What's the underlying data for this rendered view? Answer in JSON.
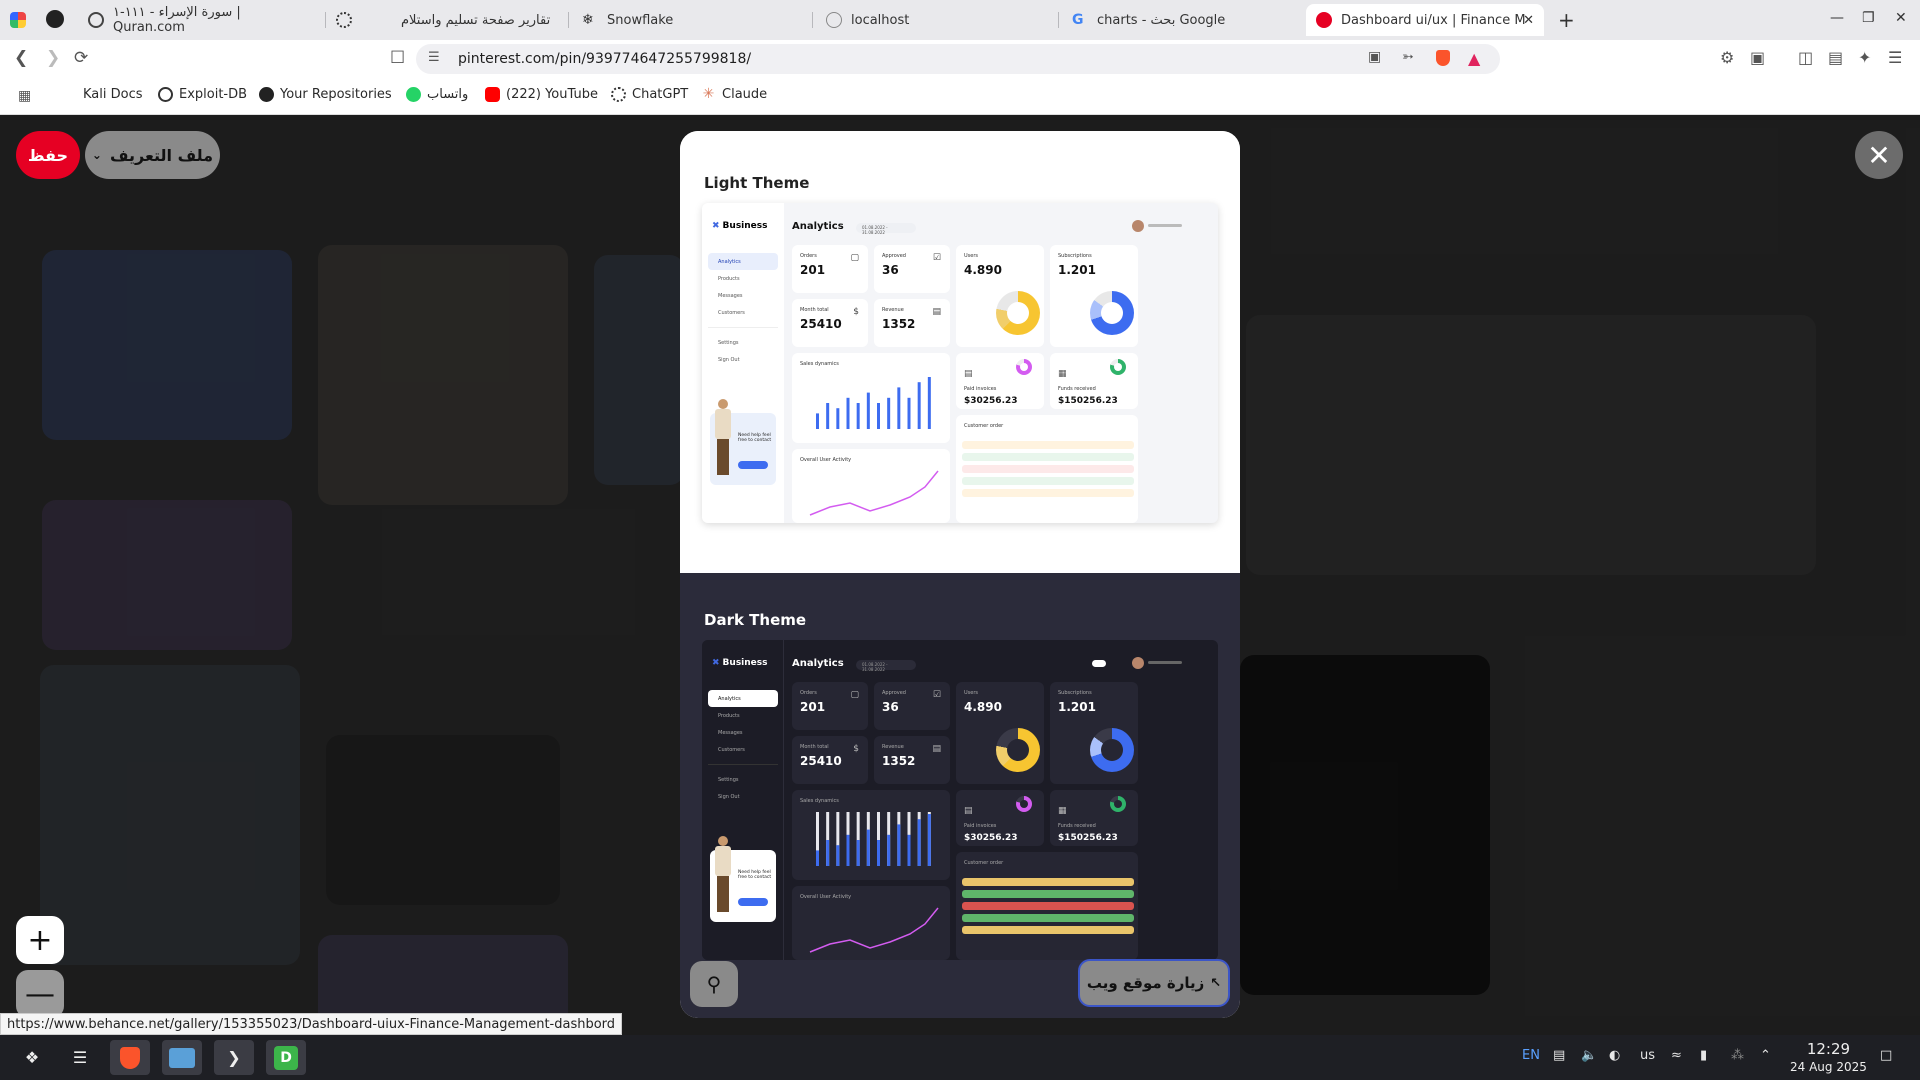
{
  "browser": {
    "tabs": [
      {
        "title": "سورة الإسراء - ١١١-١ | Quran.com",
        "icon": "quran-icon"
      },
      {
        "title": "تقارير صفحة تسليم واستلام",
        "icon": "openai-icon"
      },
      {
        "title": "Snowflake",
        "icon": "snowflake-icon"
      },
      {
        "title": "localhost",
        "icon": "globe-icon"
      },
      {
        "title": "charts - بحث Google",
        "icon": "google-icon"
      },
      {
        "title": "Dashboard ui/ux | Finance M",
        "icon": "pinterest-icon",
        "active": true
      }
    ],
    "url": "pinterest.com/pin/939774647255799818/",
    "bookmarks": [
      "Kali Docs",
      "Exploit-DB",
      "Your Repositories",
      "واتساب",
      "(222) YouTube",
      "ChatGPT",
      "Claude"
    ]
  },
  "pin_page": {
    "save_label": "حفظ",
    "profile_label": "ملف التعريف",
    "visit_label": "زيارة موقع ويب",
    "status_url": "https://www.behance.net/gallery/153355023/Dashboard-uiux-Finance-Management-dashbord"
  },
  "pin_image": {
    "light_title": "Light Theme",
    "dark_title": "Dark Theme",
    "dashboard": {
      "brand": "Business",
      "page_title": "Analytics",
      "date_range": "01.08.2022 - 31.08.2022",
      "nav": [
        "Analytics",
        "Products",
        "Messages",
        "Customers"
      ],
      "nav_bottom": [
        "Settings",
        "Sign Out"
      ],
      "help_text": "Need help feel free to contact",
      "cards": {
        "orders": {
          "label": "Orders",
          "value": "201"
        },
        "approved": {
          "label": "Approved",
          "value": "36"
        },
        "users": {
          "label": "Users",
          "value": "4.890"
        },
        "subscriptions": {
          "label": "Subscriptions",
          "value": "1.201"
        },
        "month_total": {
          "label": "Month total",
          "value": "25410"
        },
        "revenue": {
          "label": "Revenue",
          "value": "1352"
        },
        "paid_invoices": {
          "label": "Paid invoices",
          "value": "$30256.23"
        },
        "funds_received": {
          "label": "Funds received",
          "value": "$150256.23"
        }
      },
      "sales_title": "Sales dynamics",
      "sales_year": "2021",
      "activity_title": "Overall User Activity",
      "activity_year": "2021",
      "orders_title": "Customer order",
      "sales_values": [
        3,
        5,
        4,
        6,
        5,
        7,
        5,
        6,
        8,
        6,
        9,
        10
      ]
    }
  },
  "taskbar": {
    "lang": "EN",
    "layout": "us",
    "time": "12:29",
    "date": "24 Aug 2025"
  },
  "colors": {
    "pinterest_red": "#e60023",
    "accent_blue": "#3d6cf0",
    "donut_yellow": "#f7c531",
    "donut_blue": "#3d6cf0"
  }
}
